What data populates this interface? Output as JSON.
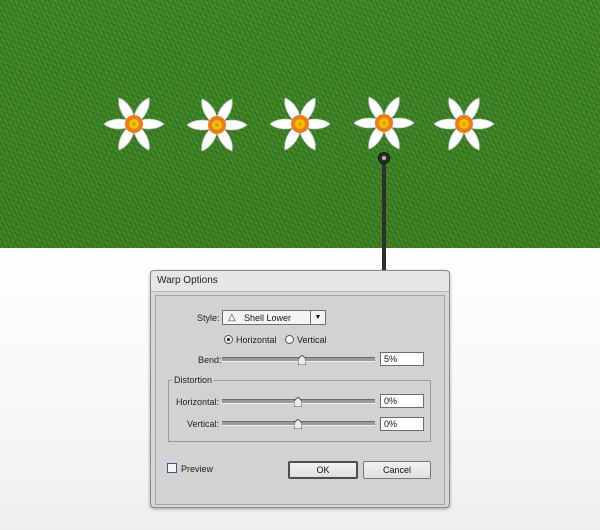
{
  "scene": {
    "flower_count": 5,
    "colors": {
      "grass": "#3c8a28",
      "petal": "#ffffff",
      "flower_center": "#f07a14",
      "flower_center_ring": "#f5c400",
      "pointer": "#2f2f2f"
    },
    "icons": [
      "daffodil-icon",
      "pointer-dot-icon"
    ]
  },
  "dialog": {
    "title": "Warp Options",
    "style_label": "Style:",
    "style_value": "Shell Lower",
    "style_icon": "shell-lower-icon",
    "orientation": {
      "horizontal_label": "Horizontal",
      "vertical_label": "Vertical",
      "selected": "Horizontal"
    },
    "bend": {
      "label": "Bend:",
      "value": "5%",
      "slider_percent": 5
    },
    "distortion": {
      "title": "Distortion",
      "horizontal": {
        "label": "Horizontal:",
        "value": "0%",
        "slider_percent": 0
      },
      "vertical": {
        "label": "Vertical:",
        "value": "0%",
        "slider_percent": 0
      }
    },
    "preview": {
      "label": "Preview",
      "checked": false
    },
    "ok_label": "OK",
    "cancel_label": "Cancel"
  }
}
